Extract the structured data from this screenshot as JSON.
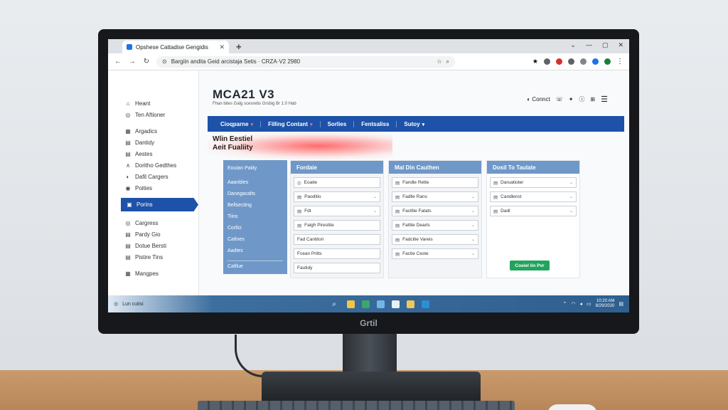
{
  "browser": {
    "tab_title": "Opshese Cattadise Gengidis",
    "address": "Bargiin andita Geid arcistaja Setis · CRZA·V2 2980",
    "icons": [
      "back-icon",
      "forward-icon",
      "reload-icon",
      "star-icon",
      "search-icon",
      "menu-icon"
    ]
  },
  "sidebar": {
    "items": [
      {
        "icon": "⌂",
        "label": "Heant"
      },
      {
        "icon": "◎",
        "label": "Ten Aftioner"
      },
      {
        "icon": "▦",
        "label": "Argadics"
      },
      {
        "icon": "▤",
        "label": "Dantidy"
      },
      {
        "icon": "▤",
        "label": "Aestes"
      },
      {
        "icon": "∧",
        "label": "Doritho Gedthes"
      },
      {
        "icon": "◐",
        "label": "Dafil Cargers"
      },
      {
        "icon": "◉",
        "label": "Poities"
      },
      {
        "icon": "▣",
        "label": "Porins"
      },
      {
        "icon": "◎",
        "label": "Cargress"
      },
      {
        "icon": "▤",
        "label": "Pardy Gio"
      },
      {
        "icon": "▤",
        "label": "Dotue Bersti"
      },
      {
        "icon": "▤",
        "label": "Pistire Tins"
      },
      {
        "icon": "▦",
        "label": "Mangpes"
      }
    ],
    "active_index": 8
  },
  "header": {
    "title": "MCA21 V3",
    "subtitle": "Fhan bites Galg scesrebs Grsbig Br 1:0 Hab",
    "account_label": "Connct"
  },
  "navbar": {
    "items": [
      {
        "label": "Cioqparne",
        "caret": true
      },
      {
        "label": "Filling Contant",
        "caret": true
      },
      {
        "label": "Sorlies",
        "caret": false
      },
      {
        "label": "Fentsaliss",
        "caret": false
      },
      {
        "label": "Sutoy",
        "caret": true
      }
    ]
  },
  "hero": {
    "line1": "Wlin Eestiel",
    "line2": "Aeit Fualiity"
  },
  "left_panel": {
    "header": "Eoutan Paiity",
    "items": [
      "Aaanbles",
      "Danegacalts",
      "Bellsecting",
      "Tiins",
      "Corlitz",
      "Catloes",
      "Aadtes"
    ],
    "footer": "Catllue"
  },
  "cards": [
    {
      "title": "Fordaie",
      "fields": [
        {
          "icon": "◎",
          "label": "Eoaite",
          "caret": false
        },
        {
          "icon": "▤",
          "label": "Paoditio",
          "caret": true
        },
        {
          "icon": "▤",
          "label": "Fdt",
          "caret": true
        },
        {
          "icon": "▤",
          "label": "Faigh Pirestite",
          "caret": false
        },
        {
          "icon": "",
          "label": "Fad Cantitori",
          "caret": false
        },
        {
          "icon": "",
          "label": "Fcean Pritts",
          "caret": false
        },
        {
          "icon": "",
          "label": "Fautidy",
          "caret": false
        }
      ]
    },
    {
      "title": "Mal Din Cauthen",
      "fields": [
        {
          "icon": "▤",
          "label": "Fandle Rette",
          "caret": false
        },
        {
          "icon": "▤",
          "label": "Fadlle Rans",
          "caret": true
        },
        {
          "icon": "▤",
          "label": "Factllie Fatats",
          "caret": true
        },
        {
          "icon": "▤",
          "label": "Fattlie Dearts",
          "caret": true
        },
        {
          "icon": "▤",
          "label": "Fadcitie Vareis",
          "caret": true
        },
        {
          "icon": "▤",
          "label": "Factie Ceste",
          "caret": true
        }
      ]
    },
    {
      "title": "Dosil To Taulate",
      "fields": [
        {
          "icon": "▤",
          "label": "Daruatioter",
          "caret": true
        },
        {
          "icon": "▤",
          "label": "Candlenst",
          "caret": true
        },
        {
          "icon": "▤",
          "label": "Dadl",
          "caret": true
        }
      ],
      "button": "Coeiel lin Pvr"
    }
  ],
  "taskbar": {
    "search_label": "Lun cutisi",
    "time": "10:20 AM",
    "date": "8/29/2020"
  },
  "monitor_brand": "Grtil",
  "colors": {
    "primary": "#1d52a8",
    "panel": "#6f98c8",
    "accent_red": "#ff6b6b",
    "success": "#22a45d"
  }
}
